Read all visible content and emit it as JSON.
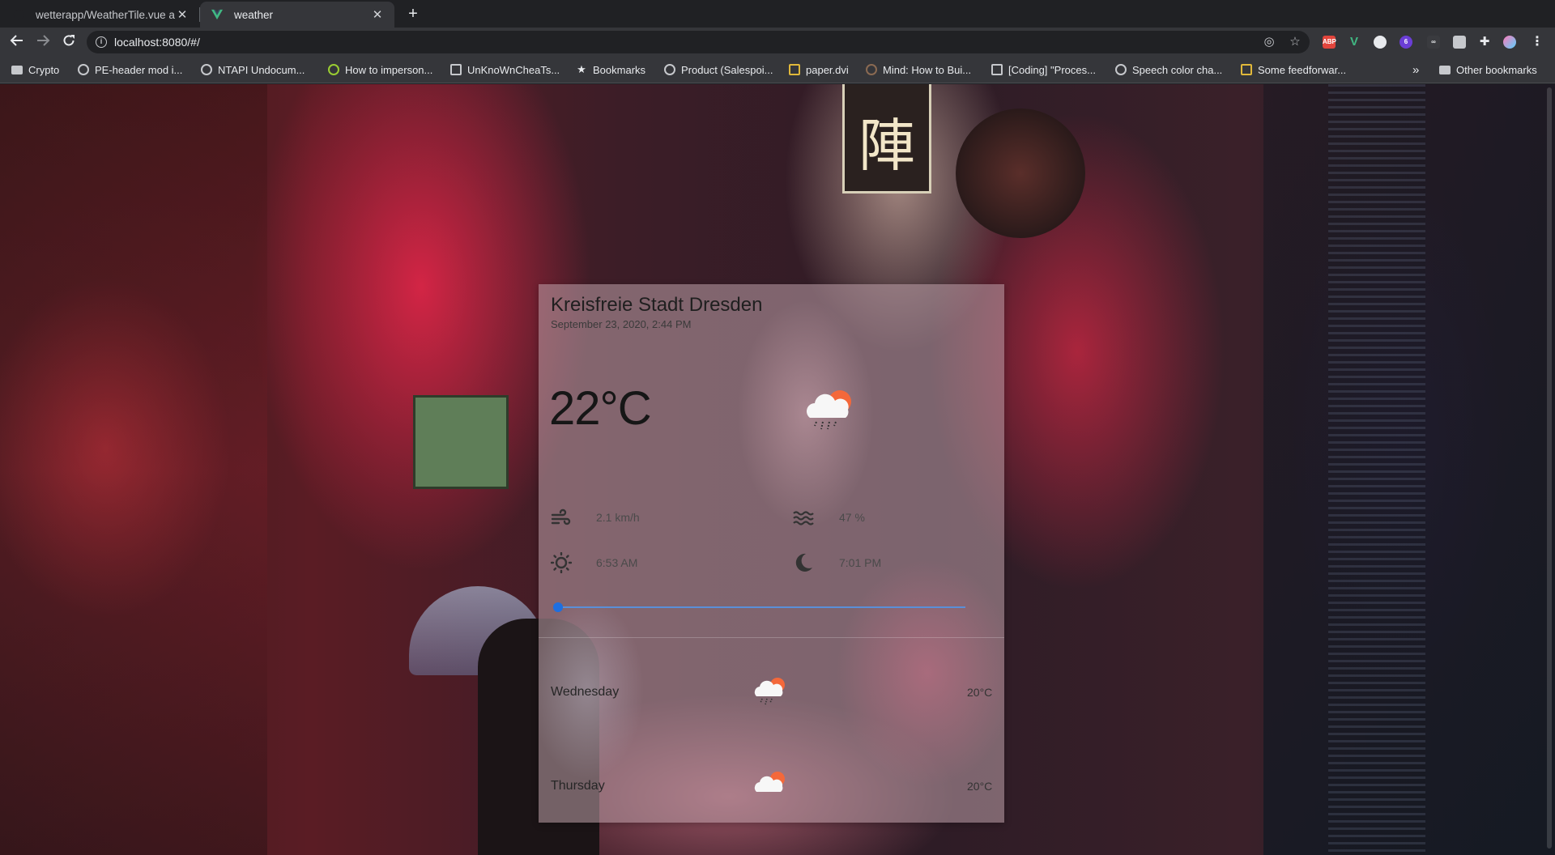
{
  "browser": {
    "tabs": [
      {
        "title": "wetterapp/WeatherTile.vue a",
        "close": "✕",
        "active": false
      },
      {
        "title": "weather",
        "close": "✕",
        "active": true
      }
    ],
    "new_tab": "+",
    "url": "localhost:8080/#/",
    "bookmarks": [
      {
        "label": "Crypto",
        "icon": "folder-icon"
      },
      {
        "label": "PE-header mod i...",
        "icon": "globe-icon"
      },
      {
        "label": "NTAPI Undocum...",
        "icon": "globe-icon"
      },
      {
        "label": "How to imperson...",
        "icon": "app-icon"
      },
      {
        "label": "UnKnoWnCheaTs...",
        "icon": "site-icon"
      },
      {
        "label": "Bookmarks",
        "icon": "star-icon"
      },
      {
        "label": "Product (Salespoi...",
        "icon": "globe-icon"
      },
      {
        "label": "paper.dvi",
        "icon": "doc-icon"
      },
      {
        "label": "Mind: How to Bui...",
        "icon": "globe-icon"
      },
      {
        "label": "[Coding] \"Proces...",
        "icon": "site-icon"
      },
      {
        "label": "Speech color cha...",
        "icon": "globe-icon"
      },
      {
        "label": "Some feedforwar...",
        "icon": "doc-icon"
      }
    ],
    "bookmarks_overflow": "»",
    "other_bookmarks": "Other bookmarks",
    "extensions": [
      "ABP",
      "V",
      "6"
    ]
  },
  "weather": {
    "city": "Kreisfreie Stadt Dresden",
    "datetime": "September 23, 2020, 2:44 PM",
    "temperature": "22°C",
    "condition_icon": "partly-cloudy-rain-icon",
    "wind": "2.1 km/h",
    "humidity": "47 %",
    "sunrise": "6:53 AM",
    "sunset": "7:01 PM",
    "time_slider_value": 0,
    "forecast": [
      {
        "day": "Wednesday",
        "icon": "partly-cloudy-rain-icon",
        "temp": "20°C"
      },
      {
        "day": "Thursday",
        "icon": "partly-cloudy-icon",
        "temp": "20°C"
      }
    ]
  },
  "colors": {
    "slider_accent": "#1e6fe0",
    "sun_orange": "#f4683a"
  }
}
